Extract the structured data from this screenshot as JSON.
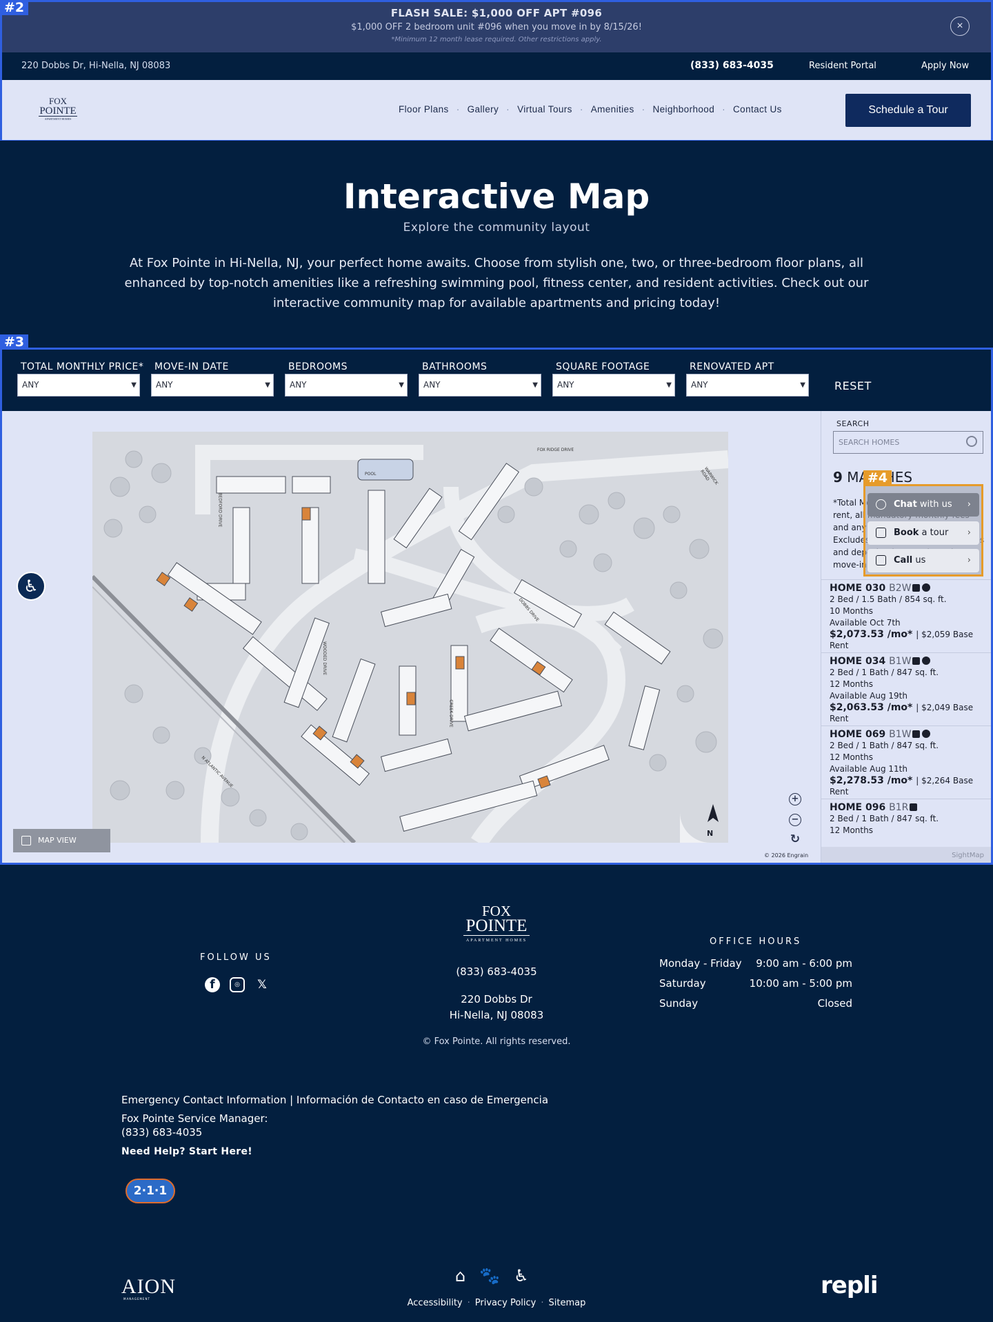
{
  "flash": {
    "title": "FLASH SALE: $1,000 OFF APT #096",
    "line": "$1,000 OFF 2 bedroom unit #096 when you move in by 8/15/26!",
    "fine": "*Minimum 12 month lease required. Other restrictions apply.",
    "close_icon": "×"
  },
  "tags": {
    "t2": "#2",
    "t3": "#3",
    "t4": "#4"
  },
  "topbar": {
    "address": "220 Dobbs Dr, Hi-Nella, NJ 08083",
    "phone": "(833) 683-4035",
    "portal": "Resident Portal",
    "apply": "Apply Now"
  },
  "nav": {
    "logo_l1": "FOX",
    "logo_l2": "POINTE",
    "logo_l3": "APARTMENT HOMES",
    "items": [
      "Floor Plans",
      "Gallery",
      "Virtual Tours",
      "Amenities",
      "Neighborhood",
      "Contact Us"
    ],
    "sep": "·",
    "cta": "Schedule a Tour"
  },
  "hero": {
    "title": "Interactive Map",
    "subtitle": "Explore the community layout",
    "description": "At Fox Pointe in Hi-Nella, NJ, your perfect home awaits. Choose from stylish one, two, or three-bedroom floor plans, all enhanced by top-notch amenities like a refreshing swimming pool, fitness center, and resident activities. Check out our interactive community map for available apartments and pricing today!"
  },
  "filters": {
    "items": [
      {
        "label": "TOTAL MONTHLY PRICE*",
        "value": "ANY"
      },
      {
        "label": "MOVE-IN DATE",
        "value": "ANY"
      },
      {
        "label": "BEDROOMS",
        "value": "ANY"
      },
      {
        "label": "BATHROOMS",
        "value": "ANY"
      },
      {
        "label": "SQUARE FOOTAGE",
        "value": "ANY"
      },
      {
        "label": "RENOVATED APT",
        "value": "ANY"
      }
    ],
    "arrow": "▼",
    "reset": "RESET"
  },
  "map": {
    "view_label": "MAP VIEW",
    "copyright": "© 2026 Engrain",
    "zoom_in": "+",
    "zoom_out": "−",
    "reset_icon": "↻",
    "north": "N",
    "pool": "POOL",
    "streets": [
      "FOX RIDGE DRIVE",
      "WARWICK ROAD",
      "N ATLANTIC AVENUE",
      "BEDFORD DRIVE",
      "DOBBS DRIVE",
      "CREEK DRIVE",
      "WOODED DRIVE"
    ]
  },
  "sidebar": {
    "search_label": "SEARCH",
    "search_placeholder": "SEARCH HOMES",
    "count": "9",
    "count_text": "MATCHES",
    "note": "*Total Monthly Price includes base rent, all mandatory monthly fees and any applicable concessions. Excludes optional, usage-based fees and deposits that are due prior to move-in.",
    "units": [
      {
        "name": "HOME 030",
        "code": "B2W",
        "specs": "2 Bed / 1.5 Bath / 854 sq. ft.",
        "term": "10 Months",
        "avail": "Available Oct 7th",
        "price": "$2,073.53 /mo*",
        "base": "| $2,059 Base Rent"
      },
      {
        "name": "HOME 034",
        "code": "B1W",
        "specs": "2 Bed / 1 Bath / 847 sq. ft.",
        "term": "12 Months",
        "avail": "Available Aug 19th",
        "price": "$2,063.53 /mo*",
        "base": "| $2,049 Base Rent"
      },
      {
        "name": "HOME 069",
        "code": "B1W",
        "specs": "2 Bed / 1 Bath / 847 sq. ft.",
        "term": "12 Months",
        "avail": "Available Aug 11th",
        "price": "$2,278.53 /mo*",
        "base": "| $2,264 Base Rent"
      },
      {
        "name": "HOME 096",
        "code": "B1R",
        "specs": "2 Bed / 1 Bath / 847 sq. ft.",
        "term": "12 Months",
        "avail": "",
        "price": "",
        "base": ""
      }
    ],
    "powered": "SightMap"
  },
  "chat": {
    "items": [
      {
        "bold": "Chat",
        "rest": " with us"
      },
      {
        "bold": "Book",
        "rest": " a tour"
      },
      {
        "bold": "Call",
        "rest": " us"
      }
    ],
    "chevron": "›"
  },
  "a11y_icon": "♿",
  "footer": {
    "logo_l1": "FOX",
    "logo_l2": "POINTE",
    "logo_l3": "APARTMENT HOMES",
    "follow": "FOLLOW US",
    "social": [
      "f",
      "◎",
      "𝕏"
    ],
    "phone": "(833) 683-4035",
    "addr1": "220 Dobbs Dr",
    "addr2": "Hi-Nella, NJ 08083",
    "copyright": "© Fox Pointe. All rights reserved.",
    "hours_title": "OFFICE HOURS",
    "hours": [
      {
        "day": "Monday - Friday",
        "time": "9:00 am - 6:00 pm"
      },
      {
        "day": "Saturday",
        "time": "10:00 am - 5:00 pm"
      },
      {
        "day": "Sunday",
        "time": "Closed"
      }
    ],
    "emergency": "Emergency Contact Information | Información de Contacto en caso de Emergencia",
    "manager": "Fox Pointe Service Manager:",
    "manager_phone": "(833) 683-4035",
    "help": "Need Help? Start Here!",
    "badge_211": "2·1·1",
    "aion": "AION",
    "aion_sub": "MANAGEMENT",
    "links": [
      "Accessibility",
      "Privacy Policy",
      "Sitemap"
    ],
    "dot": "·",
    "repli": "repli",
    "icons": [
      "⌂",
      "🐾",
      "♿"
    ]
  }
}
